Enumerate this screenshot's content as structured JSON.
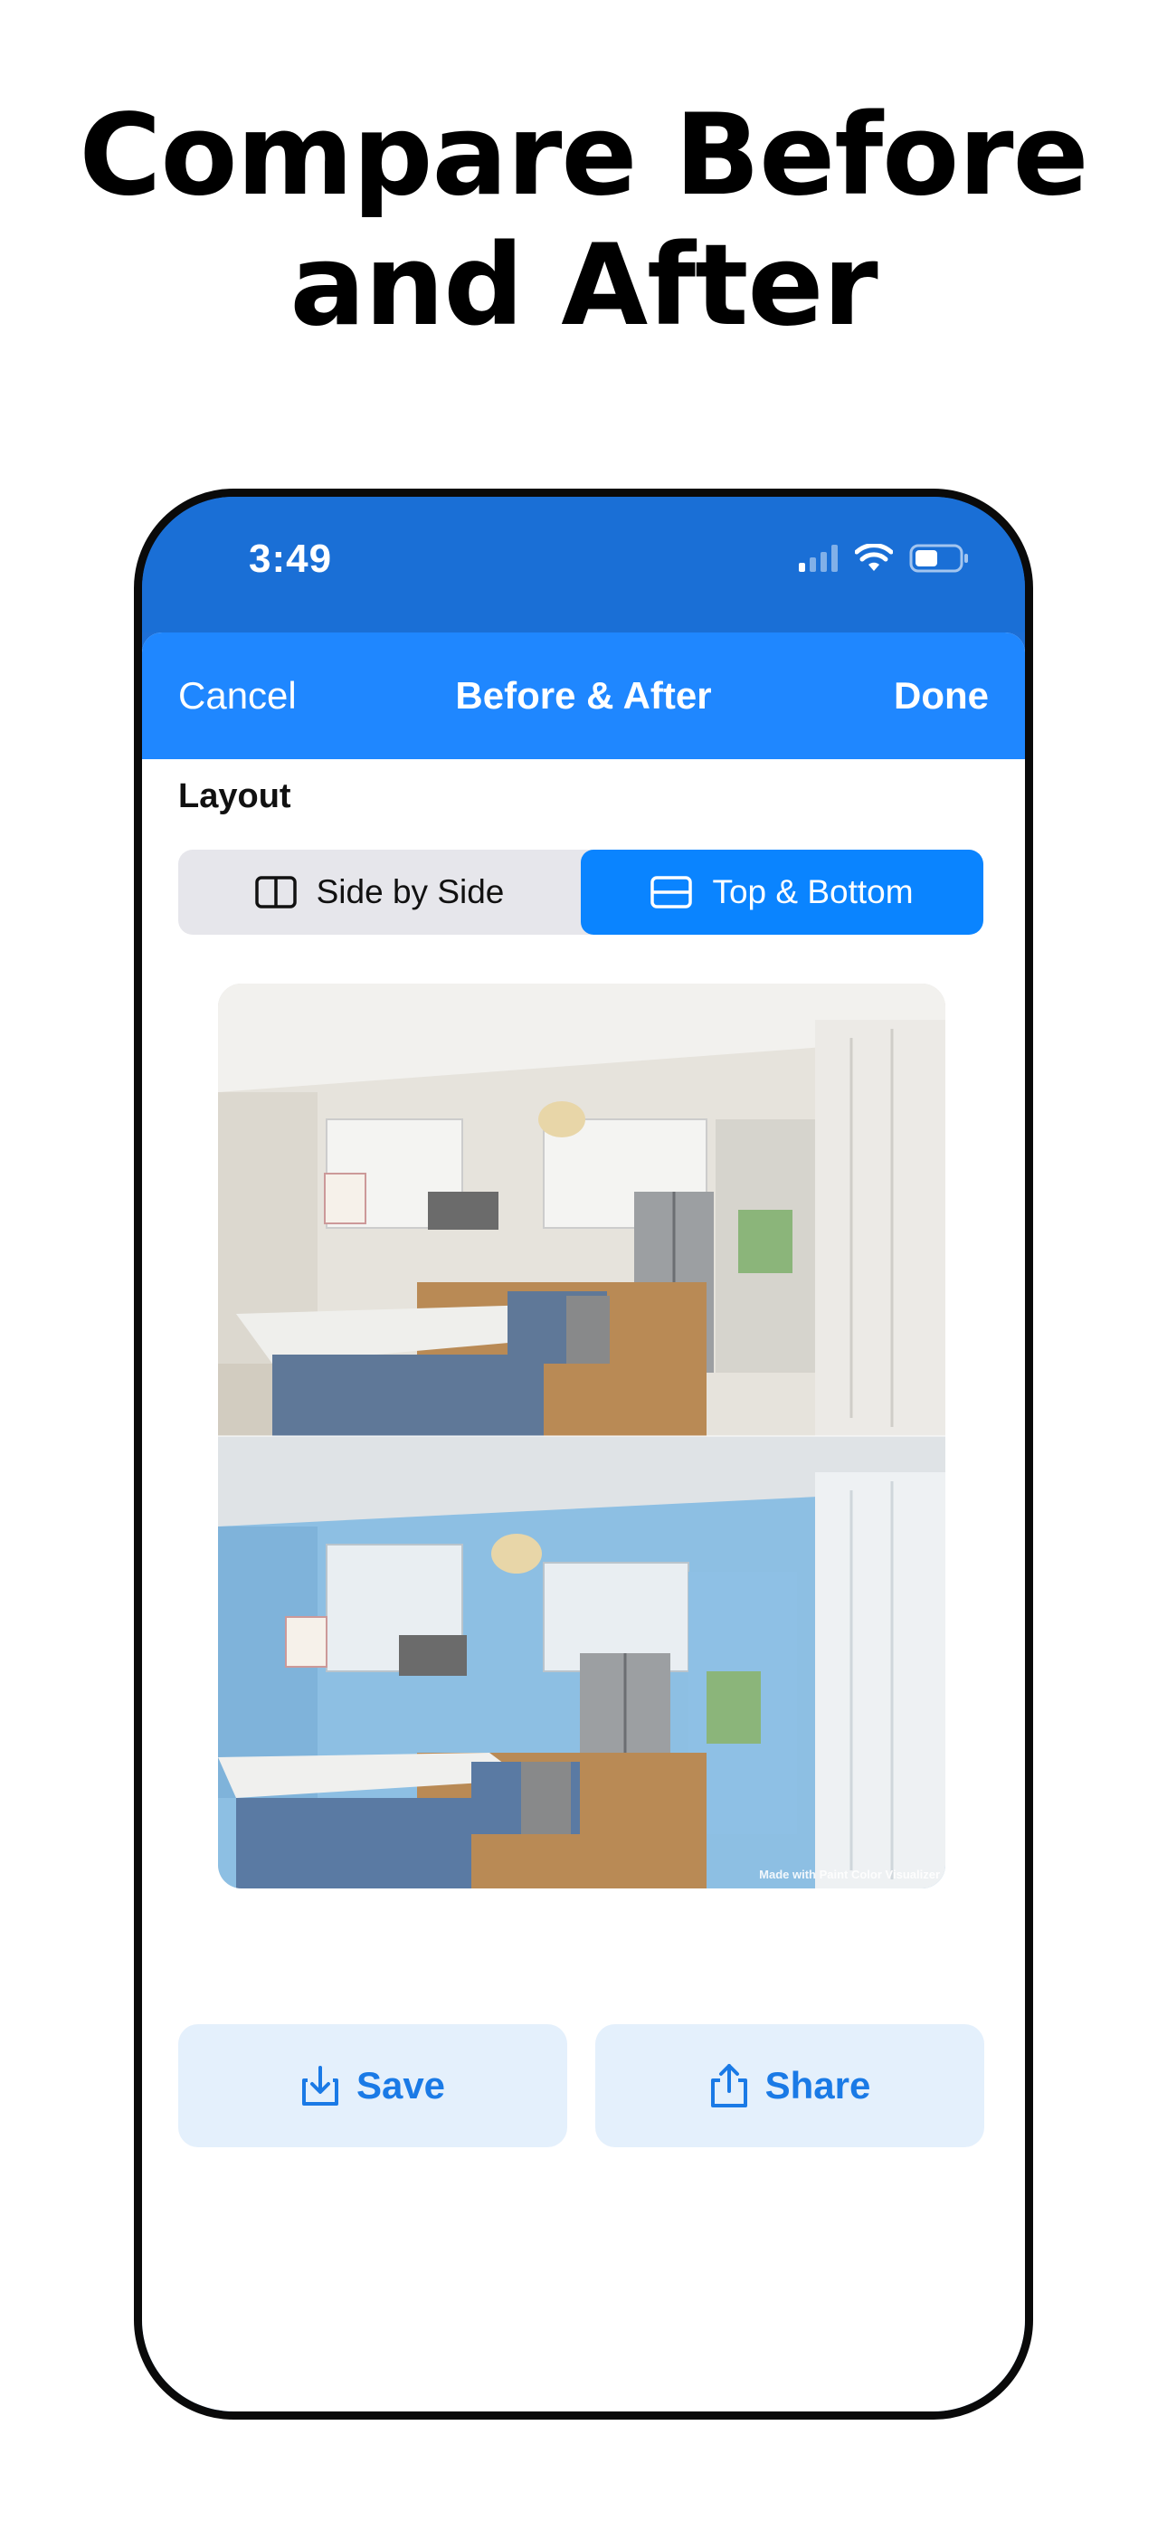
{
  "headline": {
    "line1": "Compare Before",
    "line2": "and After"
  },
  "status_bar": {
    "time": "3:49",
    "icons": [
      "signal-icon",
      "wifi-icon",
      "battery-icon"
    ]
  },
  "navbar": {
    "cancel_label": "Cancel",
    "title": "Before & After",
    "done_label": "Done"
  },
  "layout": {
    "label": "Layout",
    "options": [
      {
        "label": "Side by Side",
        "icon": "side-by-side-icon",
        "selected": false
      },
      {
        "label": "Top & Bottom",
        "icon": "top-bottom-icon",
        "selected": true
      }
    ]
  },
  "preview": {
    "watermark": "Made with Paint Color Visualizer"
  },
  "actions": {
    "save_label": "Save",
    "save_icon": "save-download-icon",
    "share_label": "Share",
    "share_icon": "share-icon"
  },
  "colors": {
    "brand_blue": "#1f87ff",
    "segment_active": "#0a84ff",
    "button_bg": "#e4f0fc",
    "button_text": "#1a7ae6"
  }
}
